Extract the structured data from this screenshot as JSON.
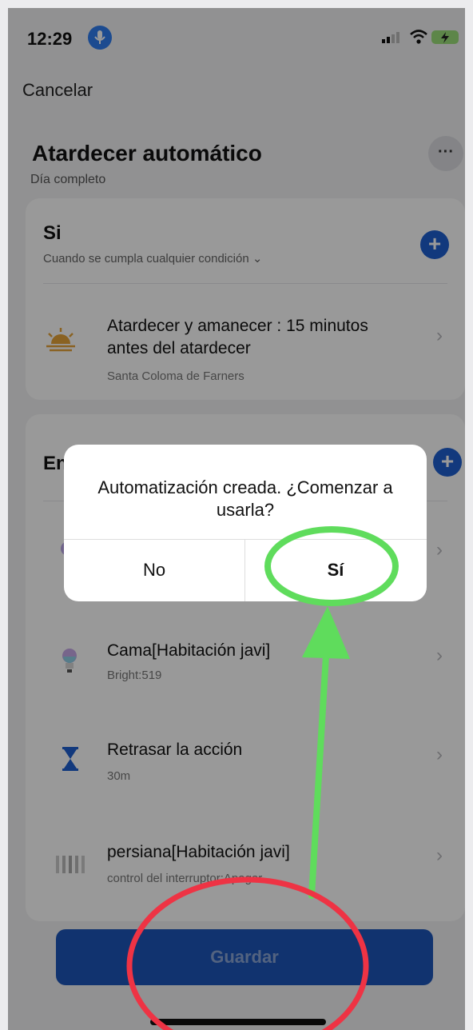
{
  "status_bar": {
    "time": "12:29"
  },
  "header": {
    "cancel_label": "Cancelar",
    "title": "Atardecer automático",
    "subtitle": "Día completo",
    "more_label": "···"
  },
  "if_section": {
    "title": "Si",
    "condition_label": "Cuando se cumpla cualquier condición ⌄",
    "add_label": "+",
    "items": [
      {
        "title": "Atardecer y amanecer : 15 minutos antes del atardecer",
        "subtitle": "Santa Coloma de Farners",
        "icon": "sunset-icon"
      }
    ]
  },
  "then_section": {
    "title": "En",
    "add_label": "+",
    "items": [
      {
        "title": "Cama[Habitación javi]",
        "subtitle": "Bright:519",
        "icon": "bulb-icon"
      },
      {
        "title": "Retrasar la acción",
        "subtitle": "30m",
        "icon": "hourglass-icon"
      },
      {
        "title": "persiana[Habitación javi]",
        "subtitle": "control del interruptor:Apagar",
        "icon": "blind-icon"
      }
    ]
  },
  "save_label": "Guardar",
  "dialog": {
    "message": "Automatización creada. ¿Comenzar a usarla?",
    "no_label": "No",
    "yes_label": "Sí"
  },
  "colors": {
    "primary": "#1f5fd0",
    "annotation_green": "#5fdc5c",
    "annotation_red": "#ee3344"
  }
}
